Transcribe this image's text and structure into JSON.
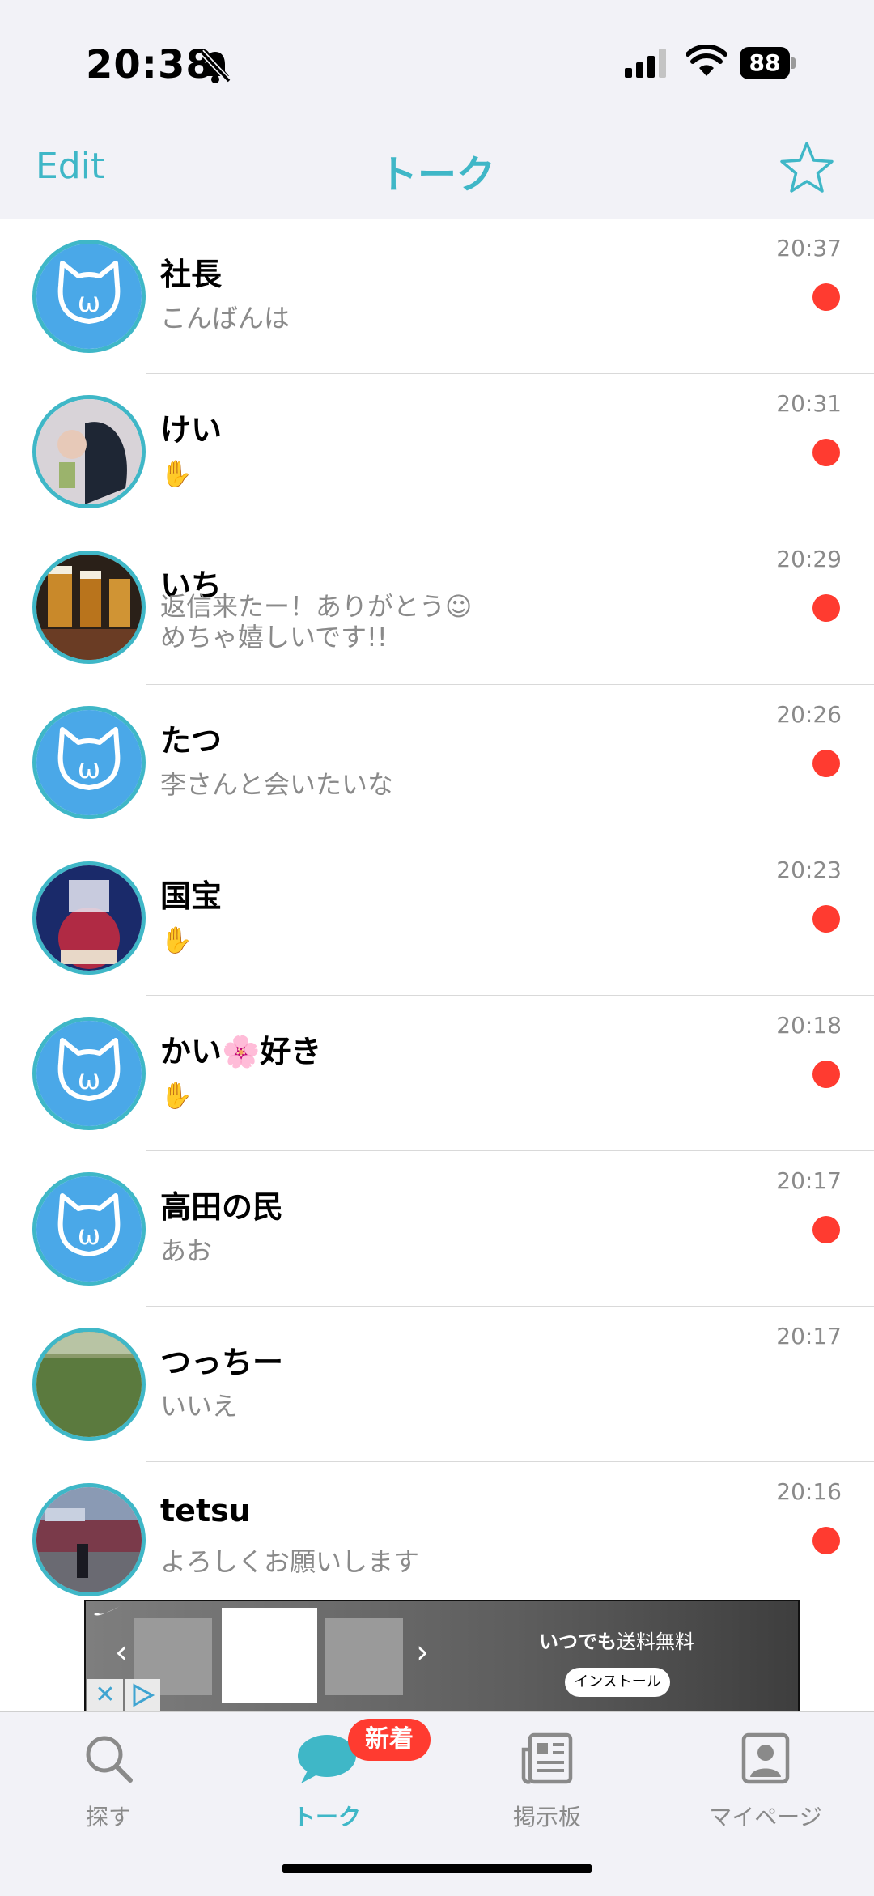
{
  "status": {
    "time": "20:38",
    "battery": "88"
  },
  "nav": {
    "edit": "Edit",
    "title": "トーク"
  },
  "conversations": [
    {
      "name": "社長",
      "message": "こんばんは",
      "time": "20:37",
      "unread": true,
      "avatar": "default-cat"
    },
    {
      "name": "けい",
      "message": "✋",
      "time": "20:31",
      "unread": true,
      "avatar": "photo-person"
    },
    {
      "name": "いち",
      "message": "返信来たー！ありがとう☺\nめちゃ嬉しいです!!",
      "time": "20:29",
      "unread": true,
      "avatar": "photo-beer"
    },
    {
      "name": "たつ",
      "message": "李さんと会いたいな",
      "time": "20:26",
      "unread": true,
      "avatar": "default-cat"
    },
    {
      "name": "国宝",
      "message": "✋",
      "time": "20:23",
      "unread": true,
      "avatar": "photo-poster"
    },
    {
      "name": "かい🌸好き",
      "message": "✋",
      "time": "20:18",
      "unread": true,
      "avatar": "default-cat"
    },
    {
      "name": "高田の民",
      "message": "あお",
      "time": "20:17",
      "unread": true,
      "avatar": "default-cat"
    },
    {
      "name": "つっちー",
      "message": "いいえ",
      "time": "20:17",
      "unread": false,
      "avatar": "photo-field"
    },
    {
      "name": "tetsu",
      "message": "よろしくお願いします",
      "time": "20:16",
      "unread": true,
      "avatar": "photo-street"
    }
  ],
  "ad": {
    "headline_bold": "いつでも",
    "headline": "送料無料",
    "install": "インストール",
    "close": "✕"
  },
  "tabs": [
    {
      "label": "探す",
      "icon": "search-icon"
    },
    {
      "label": "トーク",
      "icon": "chat-bubble-icon",
      "badge": "新着"
    },
    {
      "label": "掲示板",
      "icon": "newspaper-icon"
    },
    {
      "label": "マイページ",
      "icon": "profile-icon"
    }
  ],
  "colors": {
    "accent": "#3fb7c7",
    "unread": "#ff3b30",
    "avatar_fill": "#4aa8e8"
  }
}
